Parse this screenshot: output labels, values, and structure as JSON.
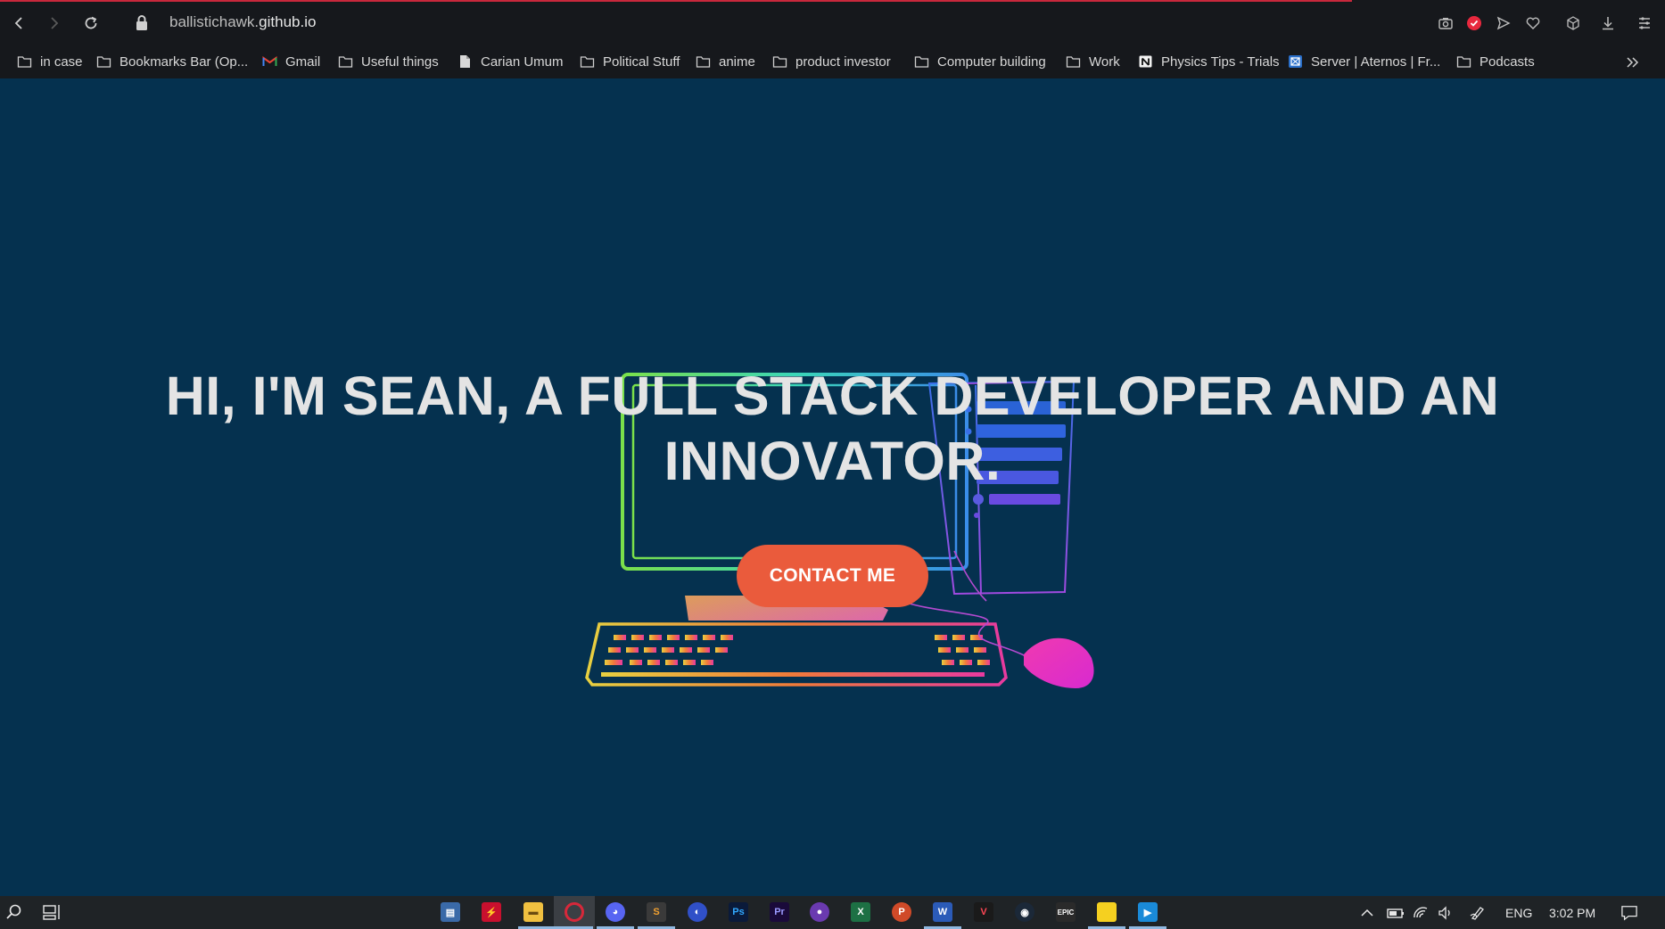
{
  "browser": {
    "url_prefix": "ballistichawk.",
    "url_domain": "github.io",
    "toolbar_icons": [
      "back-icon",
      "forward-icon",
      "reload-icon",
      "lock-icon",
      "camera-icon",
      "shield-icon",
      "send-icon",
      "heart-icon",
      "cube-icon",
      "download-icon",
      "menu-icon"
    ],
    "bookmarks": [
      {
        "label": "in case",
        "icon": "folder-icon"
      },
      {
        "label": "Bookmarks Bar (Op...",
        "icon": "folder-icon"
      },
      {
        "label": "Gmail",
        "icon": "gmail-icon"
      },
      {
        "label": "Useful things",
        "icon": "folder-icon"
      },
      {
        "label": "Carian Umum",
        "icon": "file-icon"
      },
      {
        "label": "Political Stuff",
        "icon": "folder-icon"
      },
      {
        "label": "anime",
        "icon": "folder-icon"
      },
      {
        "label": "product investor",
        "icon": "folder-icon"
      },
      {
        "label": "Computer building",
        "icon": "folder-icon"
      },
      {
        "label": "Work",
        "icon": "folder-icon"
      },
      {
        "label": "Physics Tips - Trials",
        "icon": "notion-icon"
      },
      {
        "label": "Server | Aternos | Fr...",
        "icon": "aternos-icon"
      },
      {
        "label": "Podcasts",
        "icon": "folder-icon"
      }
    ]
  },
  "hero": {
    "title": "HI, I'M SEAN, A FULL STACK DEVELOPER AND AN INNOVATOR.",
    "cta_label": "CONTACT ME"
  },
  "taskbar": {
    "apps": [
      "search-icon",
      "task-view-icon",
      "control-panel-icon",
      "adobe-acrobat-icon",
      "file-explorer-icon",
      "opera-icon",
      "discord-icon",
      "sublime-text-icon",
      "ubisoft-icon",
      "photoshop-icon",
      "premiere-icon",
      "github-desktop-icon",
      "excel-icon",
      "powerpoint-icon",
      "word-icon",
      "valorant-icon",
      "steam-icon",
      "epic-games-icon",
      "sticky-notes-icon",
      "media-player-icon"
    ],
    "language": "ENG",
    "time": "3:02 PM"
  },
  "colors": {
    "page_bg": "#05314f",
    "cta_bg": "#ea5b3c",
    "title_text": "#e4e4e4",
    "chrome_bg": "#16181c"
  }
}
